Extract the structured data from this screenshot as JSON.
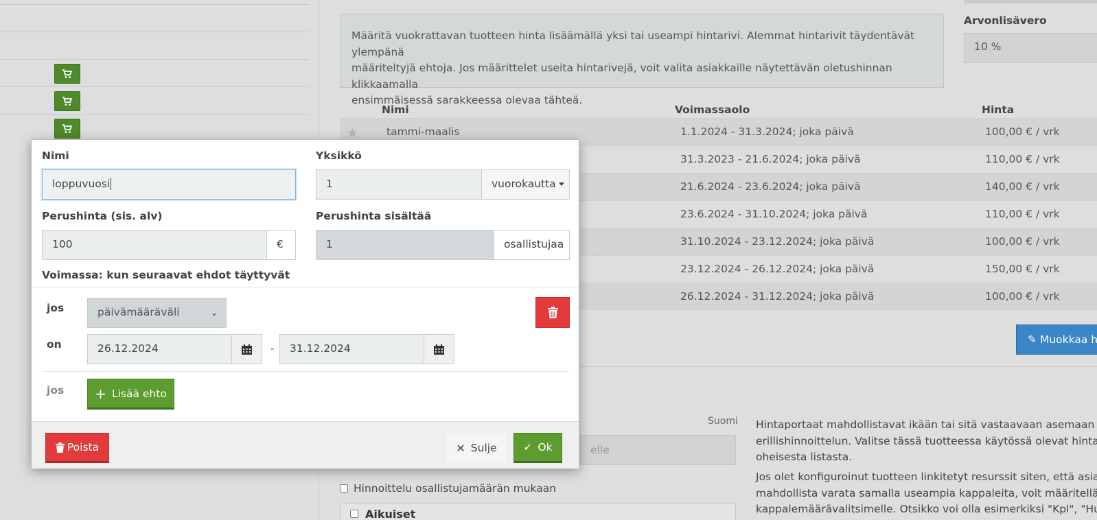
{
  "background": {
    "info_text_lines": [
      "Määritä vuokrattavan tuotteen hinta lisäämällä yksi tai useampi hintarivi. Alemmat hintarivit täydentävät ylempänä",
      "määriteltyjä ehtoja. Jos määrittelet useita hintarivejä, voit valita asiakkaille näytettävän oletushinnan klikkaamalla",
      "ensimmäisessä sarakkeessa olevaa tähteä."
    ],
    "vat_label": "Arvonlisävero",
    "vat_value": "10 %",
    "table": {
      "headers": {
        "name": "Nimi",
        "validity": "Voimassaolo",
        "price": "Hinta"
      },
      "rows": [
        {
          "name": "tammi-maalis",
          "validity": "1.1.2024 - 31.3.2024; joka päivä",
          "price": "100,00 € / vrk"
        },
        {
          "name": "",
          "validity": "31.3.2023 - 21.6.2024; joka päivä",
          "price": "110,00 € / vrk"
        },
        {
          "name": "",
          "validity": "21.6.2024 - 23.6.2024; joka päivä",
          "price": "140,00 € / vrk"
        },
        {
          "name": "",
          "validity": "23.6.2024 - 31.10.2024; joka päivä",
          "price": "110,00 € / vrk"
        },
        {
          "name": "",
          "validity": "31.10.2024 - 23.12.2024; joka päivä",
          "price": "100,00 € / vrk"
        },
        {
          "name": "",
          "validity": "23.12.2024 - 26.12.2024; joka päivä",
          "price": "150,00 € / vrk"
        },
        {
          "name": "",
          "validity": "26.12.2024 - 31.12.2024; joka päivä",
          "price": "100,00 € / vrk"
        }
      ]
    },
    "edit_button_label": "Muokkaa h",
    "language_label": "Suomi",
    "name_input_partial": "elle",
    "tier_paragraph_lines": [
      "Hintaportaat mahdollistavat ikään tai sitä vastaavaan asemaan pohja",
      "erillishinnoittelun. Valitse tässä tuotteessa käytössä olevat hintaporta",
      "oheisesta listasta."
    ],
    "resource_paragraph_lines": [
      "Jos olet konfiguroinut tuotteen linkitetyt resurssit siten, että asiakkaa",
      "mahdollista varata samalla useampia kappaleita, voit määritellä oma",
      "kappalemäärävalitsimelle. Otsikko voi olla esimerkiksi \"Kpl\", \"Huonei"
    ],
    "participant_pricing_label": "Hinnoittelu osallistujamäärän mukaan",
    "adults_label": "Aikuiset"
  },
  "modal": {
    "name_label": "Nimi",
    "name_value": "loppuvuosi",
    "unit_label": "Yksikkö",
    "unit_value": "1",
    "unit_dropdown": "vuorokautta",
    "base_price_label": "Perushinta (sis. alv)",
    "base_price_value": "100",
    "currency": "€",
    "includes_label": "Perushinta sisältää",
    "includes_value": "1",
    "includes_unit": "osallistujaa",
    "conditions_title": "Voimassa: kun seuraavat ehdot täyttyvät",
    "condition": {
      "if_label": "jos",
      "type": "päivämääräväli",
      "on_label": "on",
      "start_date": "26.12.2024",
      "separator": "-",
      "end_date": "31.12.2024"
    },
    "add_condition_if_label": "jos",
    "add_condition_label": "Lisää ehto",
    "footer": {
      "delete_label": "Poista",
      "close_label": "Sulje",
      "ok_label": "Ok"
    }
  },
  "colors": {
    "primary_green": "#5d9c2e",
    "danger_red": "#e33b3b",
    "primary_blue": "#3a86c6"
  }
}
